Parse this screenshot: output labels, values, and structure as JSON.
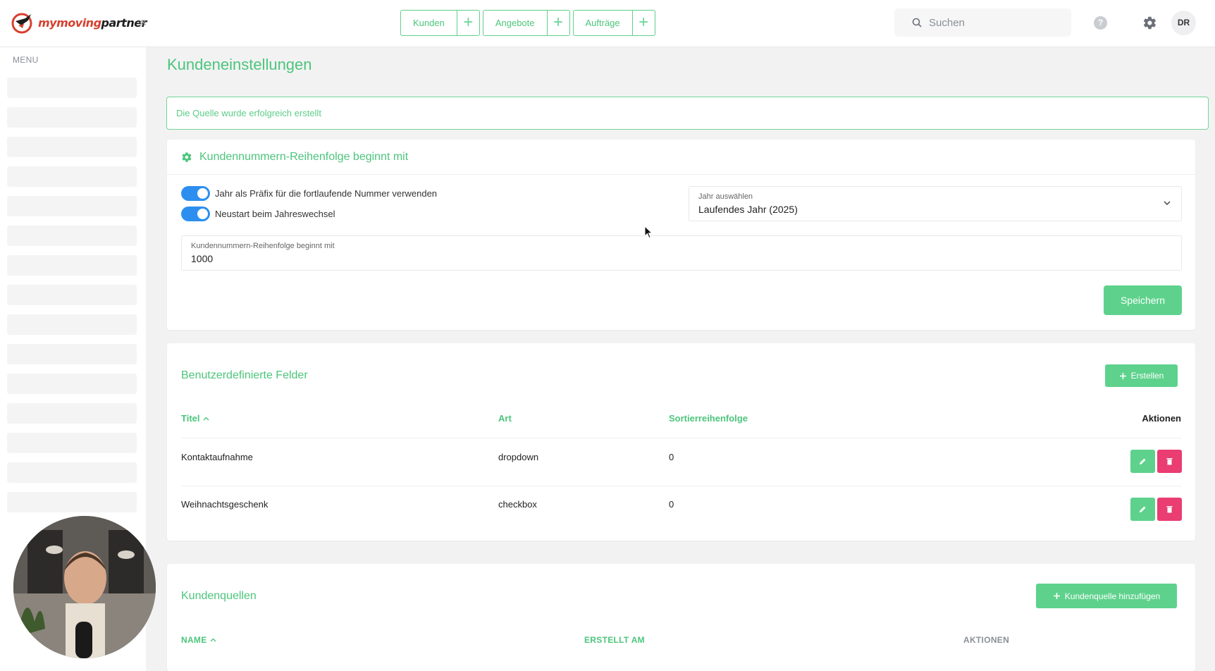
{
  "brand": {
    "name_part1": "mymoving",
    "name_part2": "partner",
    "accent": "#4cc57c",
    "danger": "#ea3d72",
    "toggle": "#2c8ff0"
  },
  "header": {
    "collapse_glyph": "«",
    "tabs": [
      {
        "label": "Kunden"
      },
      {
        "label": "Angebote"
      },
      {
        "label": "Aufträge"
      }
    ],
    "plus_glyph": "+",
    "search_placeholder": "Suchen",
    "help_glyph": "?",
    "avatar_initials": "DR"
  },
  "sidebar": {
    "menu_label": "MENU"
  },
  "page": {
    "title": "Kundeneinstellungen",
    "alert": "Die Quelle wurde erfolgreich erstellt"
  },
  "numbering": {
    "title": "Kundennummern-Reihenfolge beginnt mit",
    "toggle_prefix_label": "Jahr als Präfix für die fortlaufende Nummer verwenden",
    "toggle_prefix_on": true,
    "toggle_restart_label": "Neustart beim Jahreswechsel",
    "toggle_restart_on": true,
    "year_select_label": "Jahr auswählen",
    "year_select_value": "Laufendes Jahr (2025)",
    "start_label": "Kundennummern-Reihenfolge beginnt mit",
    "start_value": "1000",
    "save_label": "Speichern"
  },
  "custom_fields": {
    "title": "Benutzerdefinierte Felder",
    "create_label": "Erstellen",
    "columns": {
      "title": "Titel",
      "type": "Art",
      "order": "Sortierreihenfolge",
      "actions": "Aktionen"
    },
    "rows": [
      {
        "title": "Kontaktaufnahme",
        "type": "dropdown",
        "order": "0"
      },
      {
        "title": "Weihnachtsgeschenk",
        "type": "checkbox",
        "order": "0"
      }
    ]
  },
  "sources": {
    "title": "Kundenquellen",
    "add_label": "Kundenquelle hinzufügen",
    "columns": {
      "name": "NAME",
      "created": "ERSTELLT AM",
      "actions": "AKTIONEN"
    }
  }
}
